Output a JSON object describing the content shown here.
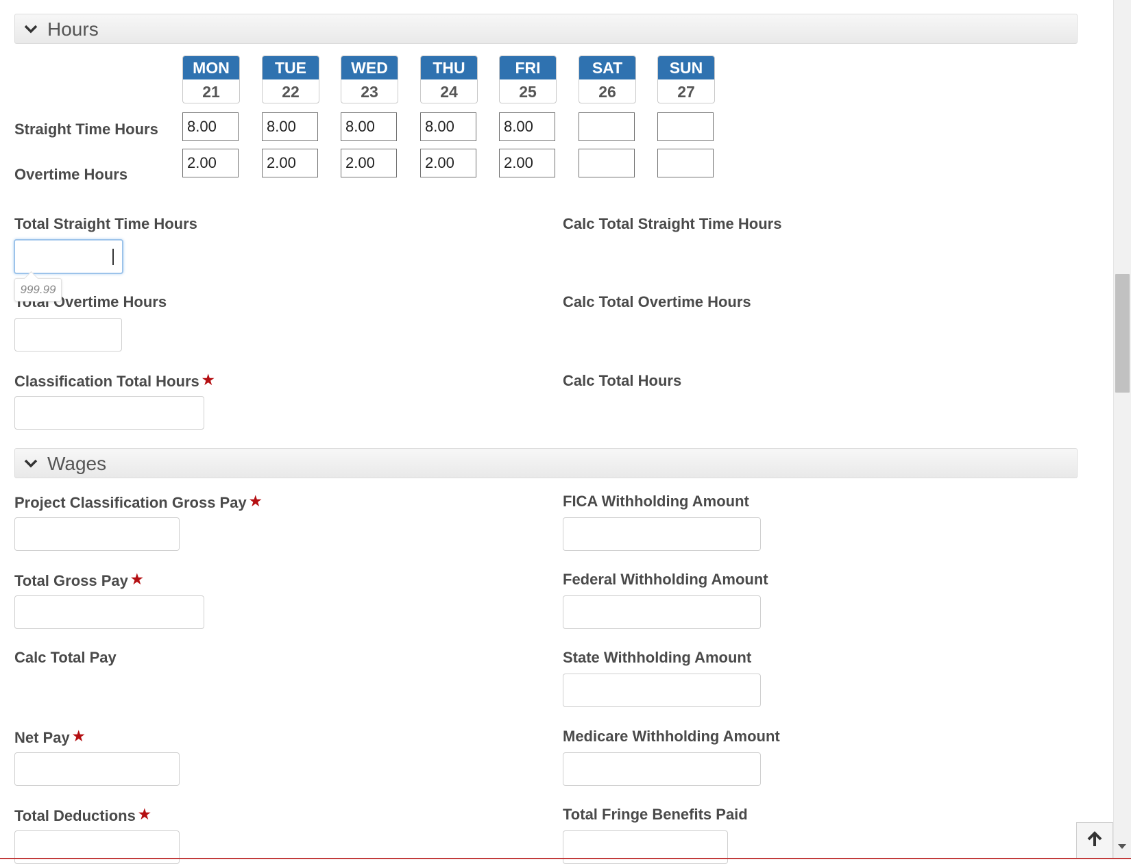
{
  "hours_section": {
    "title": "Hours",
    "days": [
      {
        "name": "MON",
        "date": "21"
      },
      {
        "name": "TUE",
        "date": "22"
      },
      {
        "name": "WED",
        "date": "23"
      },
      {
        "name": "THU",
        "date": "24"
      },
      {
        "name": "FRI",
        "date": "25"
      },
      {
        "name": "SAT",
        "date": "26"
      },
      {
        "name": "SUN",
        "date": "27"
      }
    ],
    "straight_time_label": "Straight Time Hours",
    "straight_time_values": [
      "8.00",
      "8.00",
      "8.00",
      "8.00",
      "8.00",
      "",
      ""
    ],
    "overtime_label": "Overtime Hours",
    "overtime_values": [
      "2.00",
      "2.00",
      "2.00",
      "2.00",
      "2.00",
      "",
      ""
    ],
    "total_straight_time_label": "Total Straight Time Hours",
    "total_straight_time_value": "",
    "total_straight_time_hint": "999.99",
    "calc_total_straight_time_label": "Calc Total Straight Time Hours",
    "total_overtime_label": "Total Overtime Hours",
    "total_overtime_value": "",
    "calc_total_overtime_label": "Calc Total Overtime Hours",
    "classification_total_label": "Classification Total Hours",
    "classification_total_value": "",
    "calc_total_hours_label": "Calc Total Hours"
  },
  "wages_section": {
    "title": "Wages",
    "project_classification_gross_pay_label": "Project Classification Gross Pay",
    "total_gross_pay_label": "Total Gross Pay",
    "calc_total_pay_label": "Calc Total Pay",
    "net_pay_label": "Net Pay",
    "total_deductions_label": "Total Deductions",
    "fica_label": "FICA Withholding Amount",
    "federal_label": "Federal Withholding Amount",
    "state_label": "State Withholding Amount",
    "medicare_label": "Medicare Withholding Amount",
    "fringe_label": "Total Fringe Benefits Paid"
  },
  "required_marker": "★",
  "icons": {
    "section_toggle": "chevron-down-icon",
    "back_to_top": "arrow-up-icon"
  },
  "colors": {
    "day_header": "#2f72b0",
    "required": "#b40f12",
    "focus": "#9cc3ea"
  }
}
